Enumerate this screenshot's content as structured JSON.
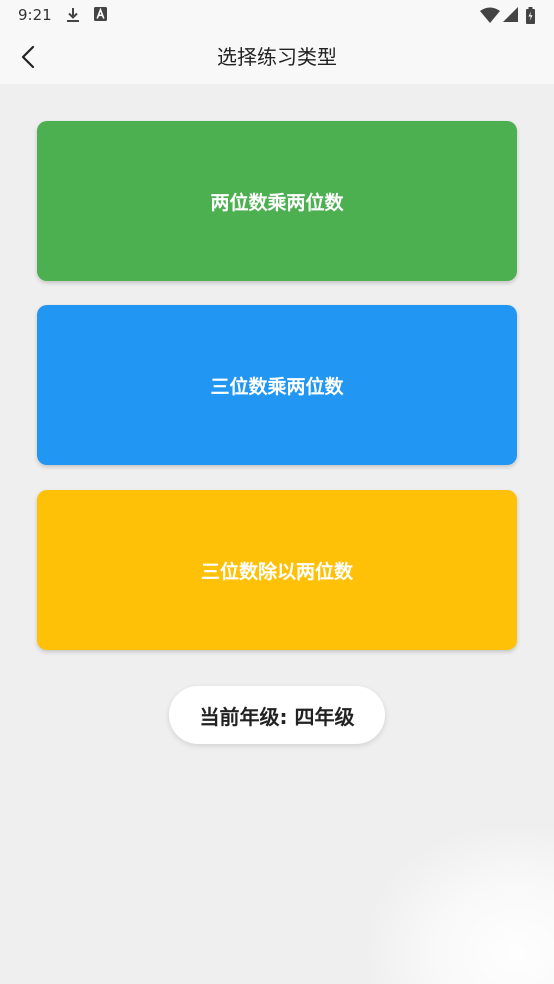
{
  "status_bar": {
    "time": "9:21",
    "icons": [
      "download-icon",
      "a-notification-icon",
      "wifi-icon",
      "signal-icon",
      "battery-icon"
    ]
  },
  "app_bar": {
    "back_icon": "chevron-left-icon",
    "title": "选择练习类型"
  },
  "practice_types": [
    {
      "label": "两位数乘两位数",
      "color": "#4caf50"
    },
    {
      "label": "三位数乘两位数",
      "color": "#2196f3"
    },
    {
      "label": "三位数除以两位数",
      "color": "#ffc107"
    }
  ],
  "grade": {
    "text": "当前年级: 四年级"
  }
}
